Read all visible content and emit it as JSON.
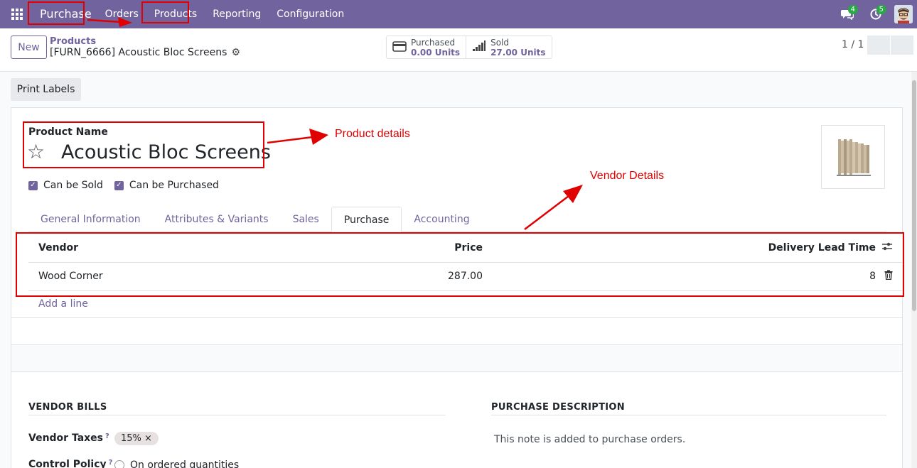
{
  "nav": {
    "brand": "Purchase",
    "items": [
      "Orders",
      "Products",
      "Reporting",
      "Configuration"
    ],
    "chat_badge": "4",
    "activity_badge": "5"
  },
  "control": {
    "new_label": "New",
    "breadcrumb_parent": "Products",
    "breadcrumb_current": "[FURN_6666] Acoustic Bloc Screens",
    "stat_purchased_label": "Purchased",
    "stat_purchased_value": "0.00 Units",
    "stat_sold_label": "Sold",
    "stat_sold_value": "27.00 Units",
    "pager": "1 / 1"
  },
  "form": {
    "print_labels": "Print Labels",
    "product_name_label": "Product Name",
    "product_name": "Acoustic Bloc Screens",
    "can_be_sold": "Can be Sold",
    "can_be_purchased": "Can be Purchased",
    "tabs": [
      "General Information",
      "Attributes & Variants",
      "Sales",
      "Purchase",
      "Accounting"
    ],
    "active_tab": "Purchase",
    "table": {
      "headers": [
        "Vendor",
        "Price",
        "Delivery Lead Time"
      ],
      "rows": [
        {
          "vendor": "Wood Corner",
          "price": "287.00",
          "lead_time": "8"
        }
      ],
      "add_line": "Add a line"
    },
    "vendor_bills_title": "VENDOR BILLS",
    "purchase_description_title": "PURCHASE DESCRIPTION",
    "vendor_taxes_label": "Vendor Taxes",
    "vendor_taxes_tag": "15% ×",
    "control_policy_label": "Control Policy",
    "control_policy_option": "On ordered quantities",
    "purchase_description_placeholder": "This note is added to purchase orders.",
    "help_mark": "?"
  },
  "annotations": {
    "product_details": "Product details",
    "vendor_details": "Vendor Details"
  },
  "colors": {
    "brand": "#71639e",
    "annotation": "#e00000",
    "badge": "#28a745"
  }
}
